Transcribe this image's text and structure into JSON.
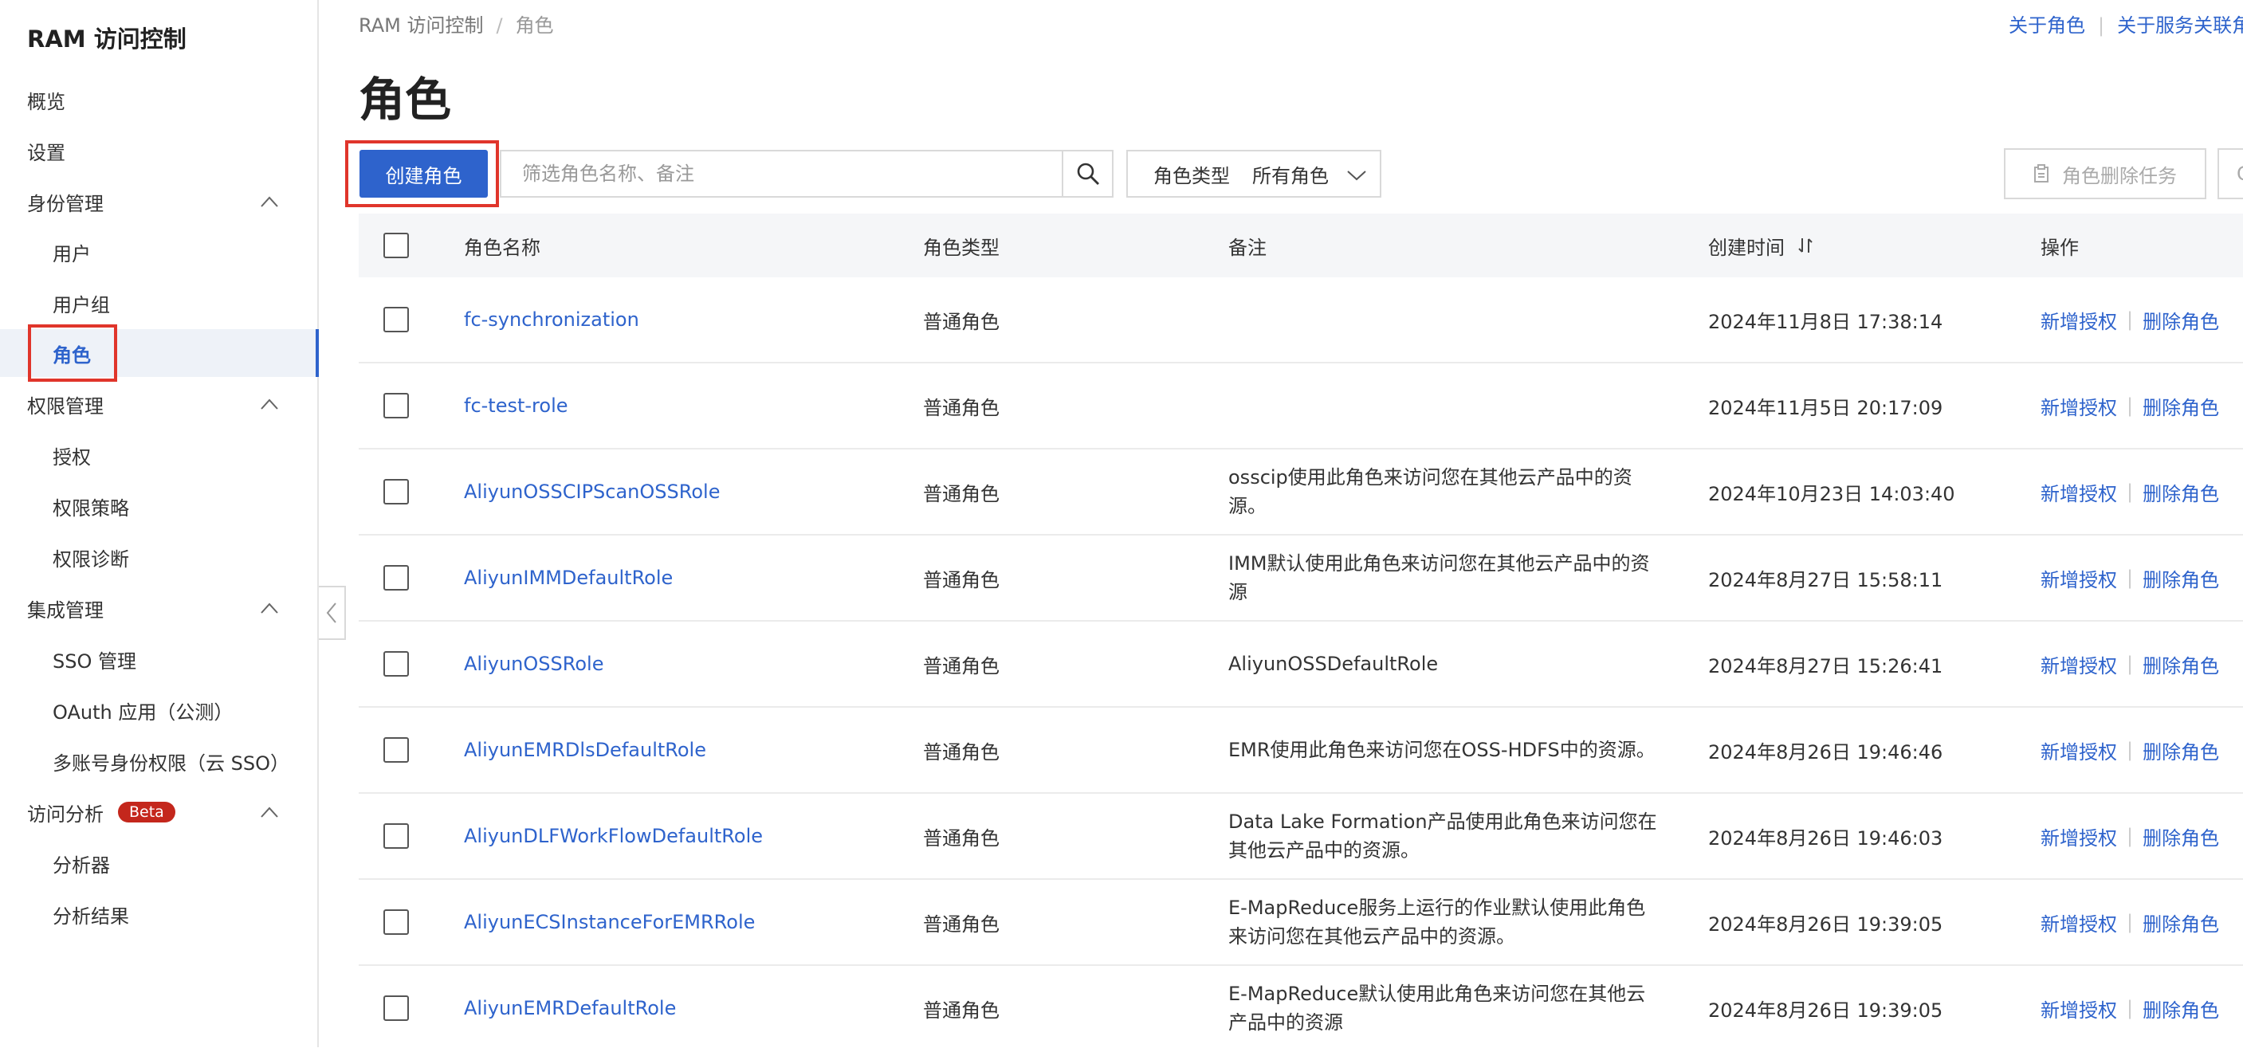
{
  "sidebar": {
    "title": "RAM 访问控制",
    "items": [
      {
        "label": "概览",
        "level": "top"
      },
      {
        "label": "设置",
        "level": "top"
      },
      {
        "label": "身份管理",
        "level": "group"
      },
      {
        "label": "用户",
        "level": "sub"
      },
      {
        "label": "用户组",
        "level": "sub"
      },
      {
        "label": "角色",
        "level": "sub",
        "active": true
      },
      {
        "label": "权限管理",
        "level": "group"
      },
      {
        "label": "授权",
        "level": "sub"
      },
      {
        "label": "权限策略",
        "level": "sub"
      },
      {
        "label": "权限诊断",
        "level": "sub"
      },
      {
        "label": "集成管理",
        "level": "group"
      },
      {
        "label": "SSO 管理",
        "level": "sub"
      },
      {
        "label": "OAuth 应用（公测）",
        "level": "sub"
      },
      {
        "label": "多账号身份权限（云 SSO）",
        "level": "sub"
      },
      {
        "label": "访问分析",
        "level": "group",
        "badge": "Beta"
      },
      {
        "label": "分析器",
        "level": "sub"
      },
      {
        "label": "分析结果",
        "level": "sub"
      }
    ]
  },
  "breadcrumb": {
    "root": "RAM 访问控制",
    "current": "角色"
  },
  "top_links": {
    "about_role": "关于角色",
    "about_linked": "关于服务关联角"
  },
  "page_title": "角色",
  "toolbar": {
    "create_label": "创建角色",
    "search_placeholder": "筛选角色名称、备注",
    "type_filter_label": "角色类型",
    "type_filter_value": "所有角色",
    "delete_task_label": "角色删除任务",
    "partial_button_text": "C"
  },
  "table": {
    "headers": {
      "name": "角色名称",
      "type": "角色类型",
      "note": "备注",
      "created": "创建时间",
      "ops": "操作"
    },
    "op_labels": {
      "grant": "新增授权",
      "delete": "删除角色"
    },
    "rows": [
      {
        "name": "fc-synchronization",
        "type": "普通角色",
        "note": "",
        "created": "2024年11月8日 17:38:14"
      },
      {
        "name": "fc-test-role",
        "type": "普通角色",
        "note": "",
        "created": "2024年11月5日 20:17:09"
      },
      {
        "name": "AliyunOSSCIPScanOSSRole",
        "type": "普通角色",
        "note": "osscip使用此角色来访问您在其他云产品中的资源。",
        "created": "2024年10月23日 14:03:40"
      },
      {
        "name": "AliyunIMMDefaultRole",
        "type": "普通角色",
        "note": "IMM默认使用此角色来访问您在其他云产品中的资源",
        "created": "2024年8月27日 15:58:11"
      },
      {
        "name": "AliyunOSSRole",
        "type": "普通角色",
        "note": "AliyunOSSDefaultRole",
        "created": "2024年8月27日 15:26:41"
      },
      {
        "name": "AliyunEMRDlsDefaultRole",
        "type": "普通角色",
        "note": "EMR使用此角色来访问您在OSS-HDFS中的资源。",
        "created": "2024年8月26日 19:46:46"
      },
      {
        "name": "AliyunDLFWorkFlowDefaultRole",
        "type": "普通角色",
        "note": "Data Lake Formation产品使用此角色来访问您在其他云产品中的资源。",
        "created": "2024年8月26日 19:46:03"
      },
      {
        "name": "AliyunECSInstanceForEMRRole",
        "type": "普通角色",
        "note": "E-MapReduce服务上运行的作业默认使用此角色来访问您在其他云产品中的资源。",
        "created": "2024年8月26日 19:39:05"
      },
      {
        "name": "AliyunEMRDefaultRole",
        "type": "普通角色",
        "note": "E-MapReduce默认使用此角色来访问您在其他云产品中的资源",
        "created": "2024年8月26日 19:39:05"
      }
    ]
  },
  "colors": {
    "accent": "#2e63cc",
    "highlight": "#e0352b",
    "beta": "#c4271c"
  }
}
